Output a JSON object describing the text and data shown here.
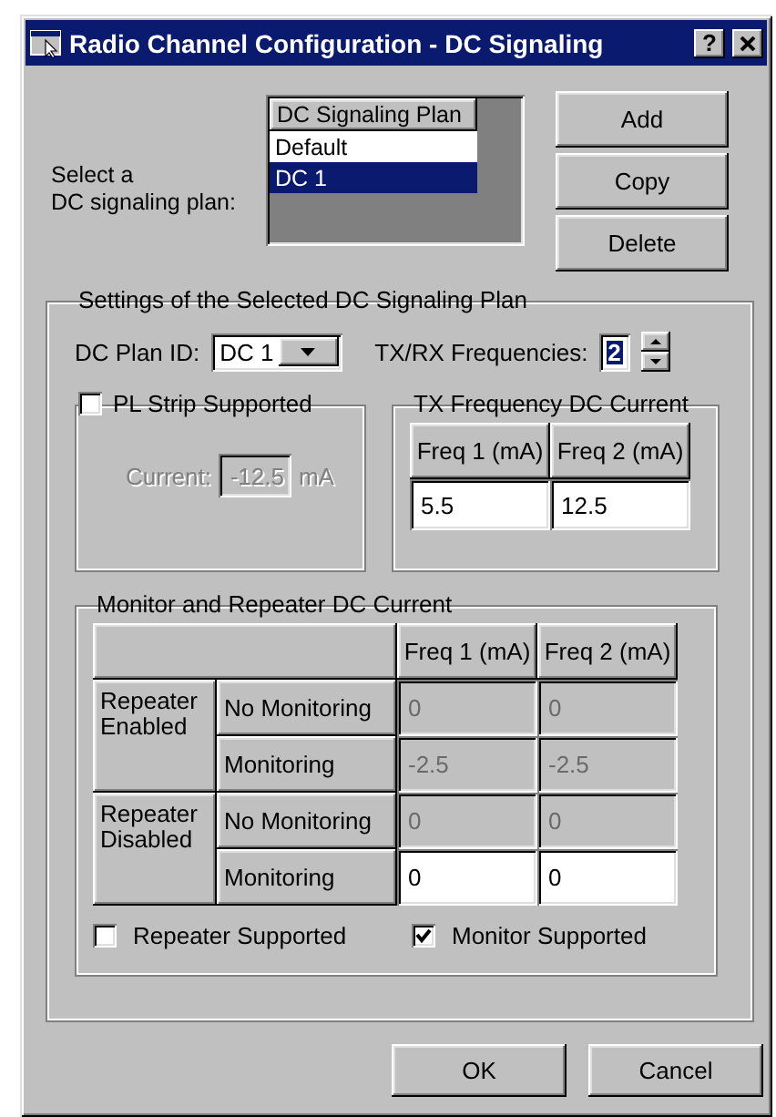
{
  "window": {
    "title": "Radio Channel Configuration - DC Signaling",
    "help": "?"
  },
  "plan_select": {
    "label": "Select a\nDC signaling plan:",
    "header": "DC Signaling Plan",
    "items": [
      {
        "label": "Default",
        "selected": false
      },
      {
        "label": "DC 1",
        "selected": true
      }
    ]
  },
  "side_buttons": [
    "Add",
    "Copy",
    "Delete"
  ],
  "settings": {
    "title": "Settings of the Selected DC Signaling Plan",
    "plan_id": {
      "label": "DC Plan ID:",
      "value": "DC 1"
    },
    "frequencies": {
      "label": "TX/RX Frequencies:",
      "value": "2"
    },
    "pl_strip": {
      "label": "PL Strip Supported",
      "checked": false,
      "current_label": "Current:",
      "current_value": "-12.5",
      "unit": "mA",
      "disabled": true
    },
    "tx_current": {
      "title": "TX Frequency DC Current",
      "columns": [
        "Freq 1 (mA)",
        "Freq 2 (mA)"
      ],
      "values": [
        "5.5",
        "12.5"
      ]
    },
    "monitor": {
      "title": "Monitor and Repeater DC Current",
      "columns": [
        "Freq 1 (mA)",
        "Freq 2 (mA)"
      ],
      "groups": [
        {
          "label": "Repeater Enabled",
          "rows": [
            {
              "label": "No Monitoring",
              "values": [
                "0",
                "0"
              ],
              "disabled": true
            },
            {
              "label": "Monitoring",
              "values": [
                "-2.5",
                "-2.5"
              ],
              "disabled": true
            }
          ]
        },
        {
          "label": "Repeater Disabled",
          "rows": [
            {
              "label": "No Monitoring",
              "values": [
                "0",
                "0"
              ],
              "disabled": true
            },
            {
              "label": "Monitoring",
              "values": [
                "0",
                "0"
              ],
              "disabled": false
            }
          ]
        }
      ],
      "checkboxes": [
        {
          "label": "Repeater Supported",
          "checked": false
        },
        {
          "label": "Monitor Supported",
          "checked": true
        }
      ]
    }
  },
  "footer_buttons": [
    "OK",
    "Cancel"
  ]
}
